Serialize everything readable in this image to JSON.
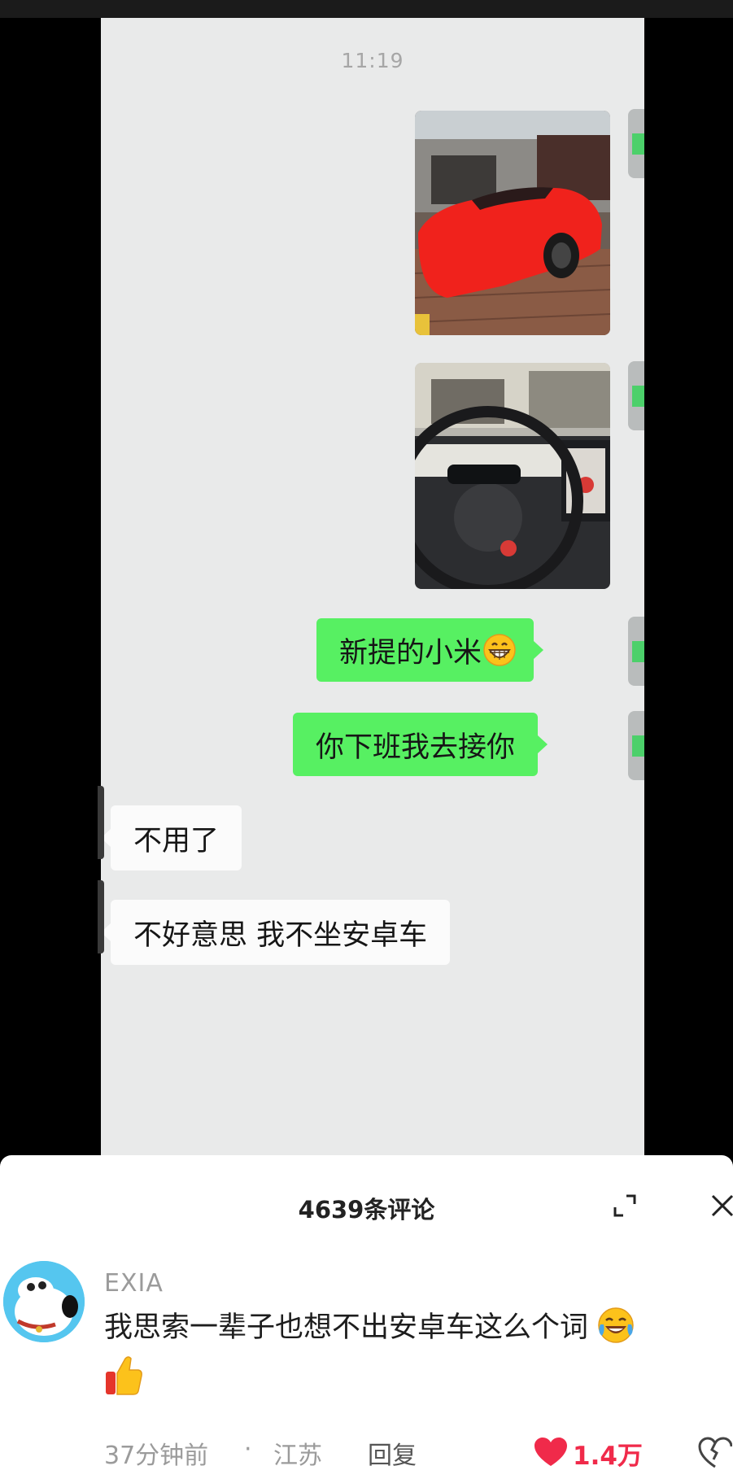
{
  "chat": {
    "time": "11:19",
    "messages": [
      {
        "type": "image",
        "direction": "out",
        "subject": "red car"
      },
      {
        "type": "image",
        "direction": "out",
        "subject": "car interior"
      },
      {
        "type": "text",
        "direction": "out",
        "text": "新提的小米",
        "emoji": "grin-icon"
      },
      {
        "type": "text",
        "direction": "out",
        "text": "你下班我去接你"
      },
      {
        "type": "text",
        "direction": "in",
        "text": "不用了"
      },
      {
        "type": "text",
        "direction": "in",
        "text": "不好意思 我不坐安卓车"
      }
    ]
  },
  "comments": {
    "title": "4639条评论",
    "items": [
      {
        "user": "EXIA",
        "text": "我思索一辈子也想不出安卓车这么个词",
        "emojis": [
          "laughing-tears-icon",
          "thumbs-up-icon"
        ],
        "time": "37分钟前",
        "separator": "·",
        "location": "江苏",
        "reply_label": "回复",
        "likes": "1.4万"
      }
    ]
  },
  "colors": {
    "out_bubble": "#57f062",
    "in_bubble": "#fbfbfb",
    "chat_bg": "#e9eaea",
    "like": "#f02a4a"
  }
}
